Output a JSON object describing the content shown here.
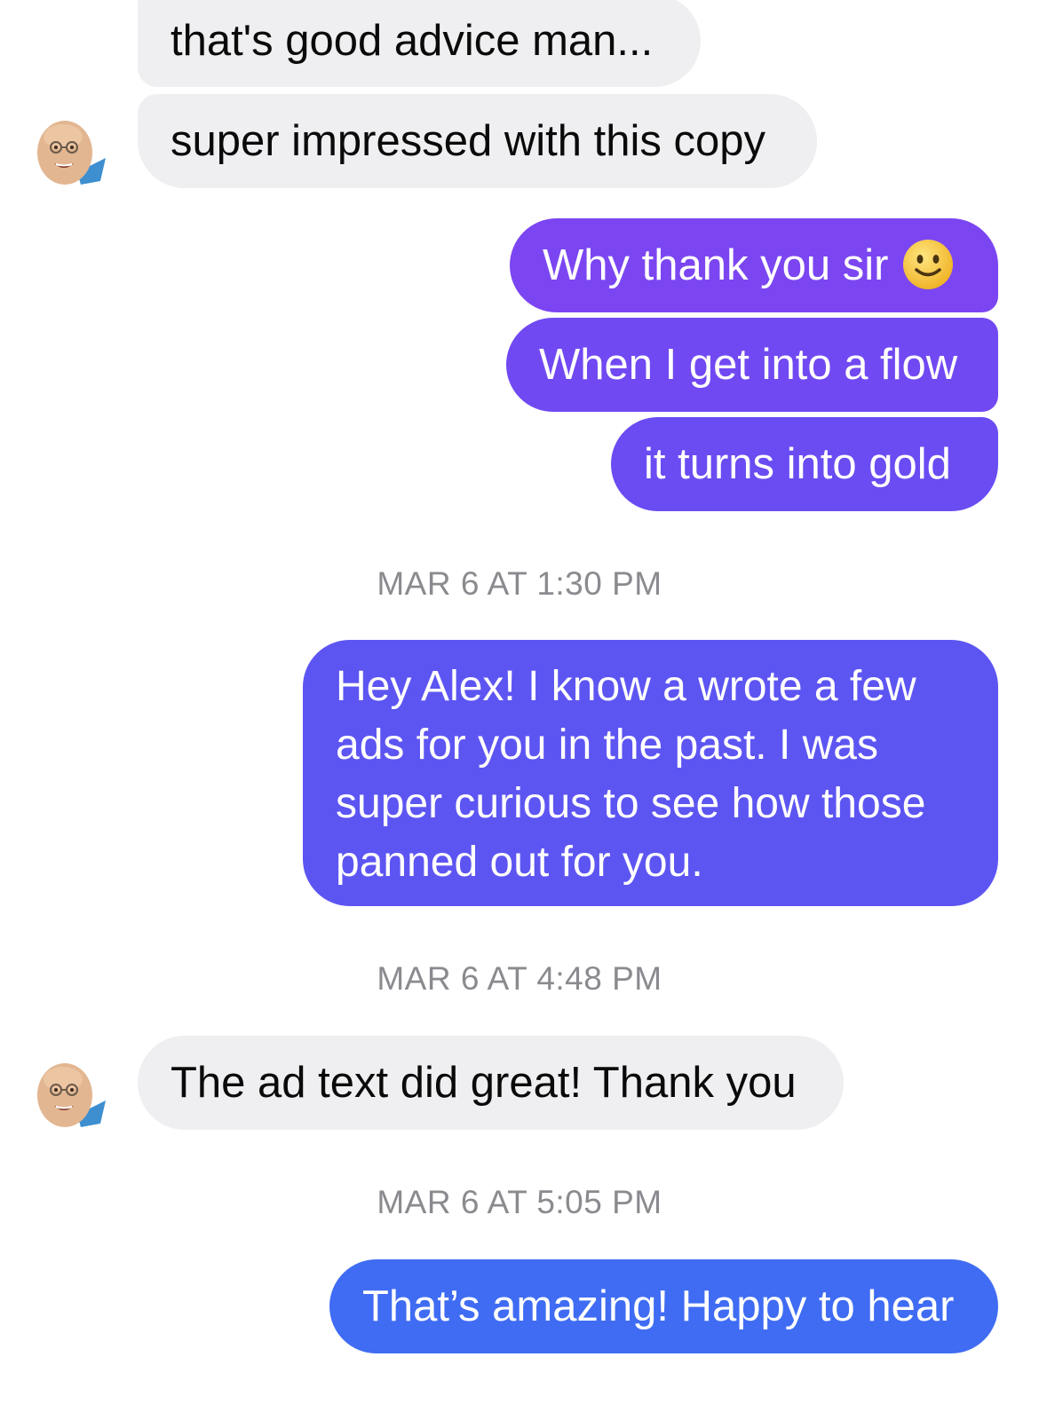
{
  "messages": {
    "m1": "that's good advice man...",
    "m2": "super impressed with this copy",
    "m3": "Why thank you sir",
    "m4": "When I get into a flow",
    "m5": "it turns into gold",
    "m6": "Hey Alex! I know a wrote a few ads for you in the past. I was super curious to see how those panned out for you.",
    "m7": "The ad text did great! Thank you",
    "m8": "That’s amazing! Happy to hear"
  },
  "timestamps": {
    "t1": "MAR 6 AT 1:30 PM",
    "t2": "MAR 6 AT 4:48 PM",
    "t3": "MAR 6 AT 5:05 PM"
  },
  "icons": {
    "emoji": "slightly-smiling-face",
    "avatar": "contact-avatar"
  },
  "colors": {
    "incoming_bubble": "#efeff1",
    "outgoing_purple": "#7c46f0",
    "outgoing_violet": "#5d55f2",
    "outgoing_blue": "#3f6cf3",
    "timestamp": "#8a8a8f"
  }
}
